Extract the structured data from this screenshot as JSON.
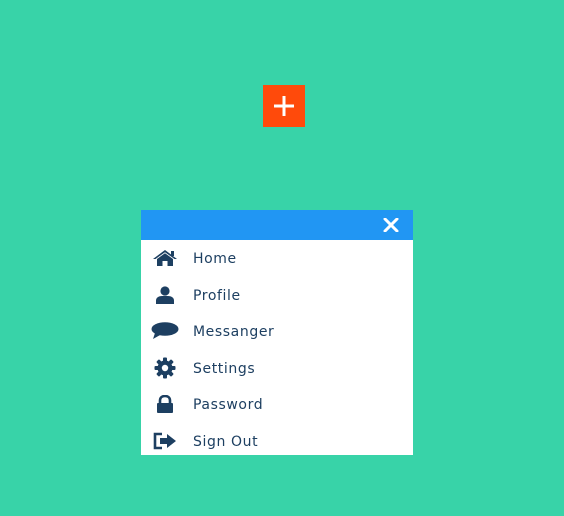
{
  "add_button": {
    "icon": "plus-icon",
    "color": "#ff4a0b"
  },
  "menu": {
    "header_color": "#2196f3",
    "close_icon": "close-icon",
    "text_color": "#1d3f61",
    "items": [
      {
        "label": "Home",
        "icon": "home-icon"
      },
      {
        "label": "Profile",
        "icon": "user-icon"
      },
      {
        "label": "Messanger",
        "icon": "chat-bubble-icon"
      },
      {
        "label": "Settings",
        "icon": "gear-icon"
      },
      {
        "label": "Password",
        "icon": "lock-icon"
      },
      {
        "label": "Sign Out",
        "icon": "sign-out-icon"
      }
    ]
  },
  "background_color": "#38d3a8"
}
